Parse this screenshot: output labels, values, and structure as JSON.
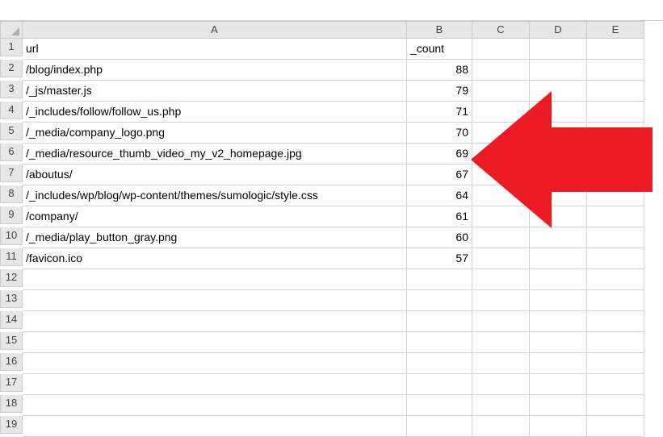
{
  "columns": [
    "A",
    "B",
    "C",
    "D",
    "E"
  ],
  "headerRow": {
    "A": "url",
    "B": "_count"
  },
  "rows": [
    {
      "A": "/blog/index.php",
      "B": 88
    },
    {
      "A": "/_js/master.js",
      "B": 79
    },
    {
      "A": "/_includes/follow/follow_us.php",
      "B": 71
    },
    {
      "A": "/_media/company_logo.png",
      "B": 70
    },
    {
      "A": "/_media/resource_thumb_video_my_v2_homepage.jpg",
      "B": 69
    },
    {
      "A": "/aboutus/",
      "B": 67
    },
    {
      "A": "/_includes/wp/blog/wp-content/themes/sumologic/style.css",
      "B": 64
    },
    {
      "A": "/company/",
      "B": 61
    },
    {
      "A": "/_media/play_button_gray.png",
      "B": 60
    },
    {
      "A": "/favicon.ico",
      "B": 57
    }
  ],
  "totalRows": 19,
  "arrow": {
    "color": "#ed1c24"
  }
}
